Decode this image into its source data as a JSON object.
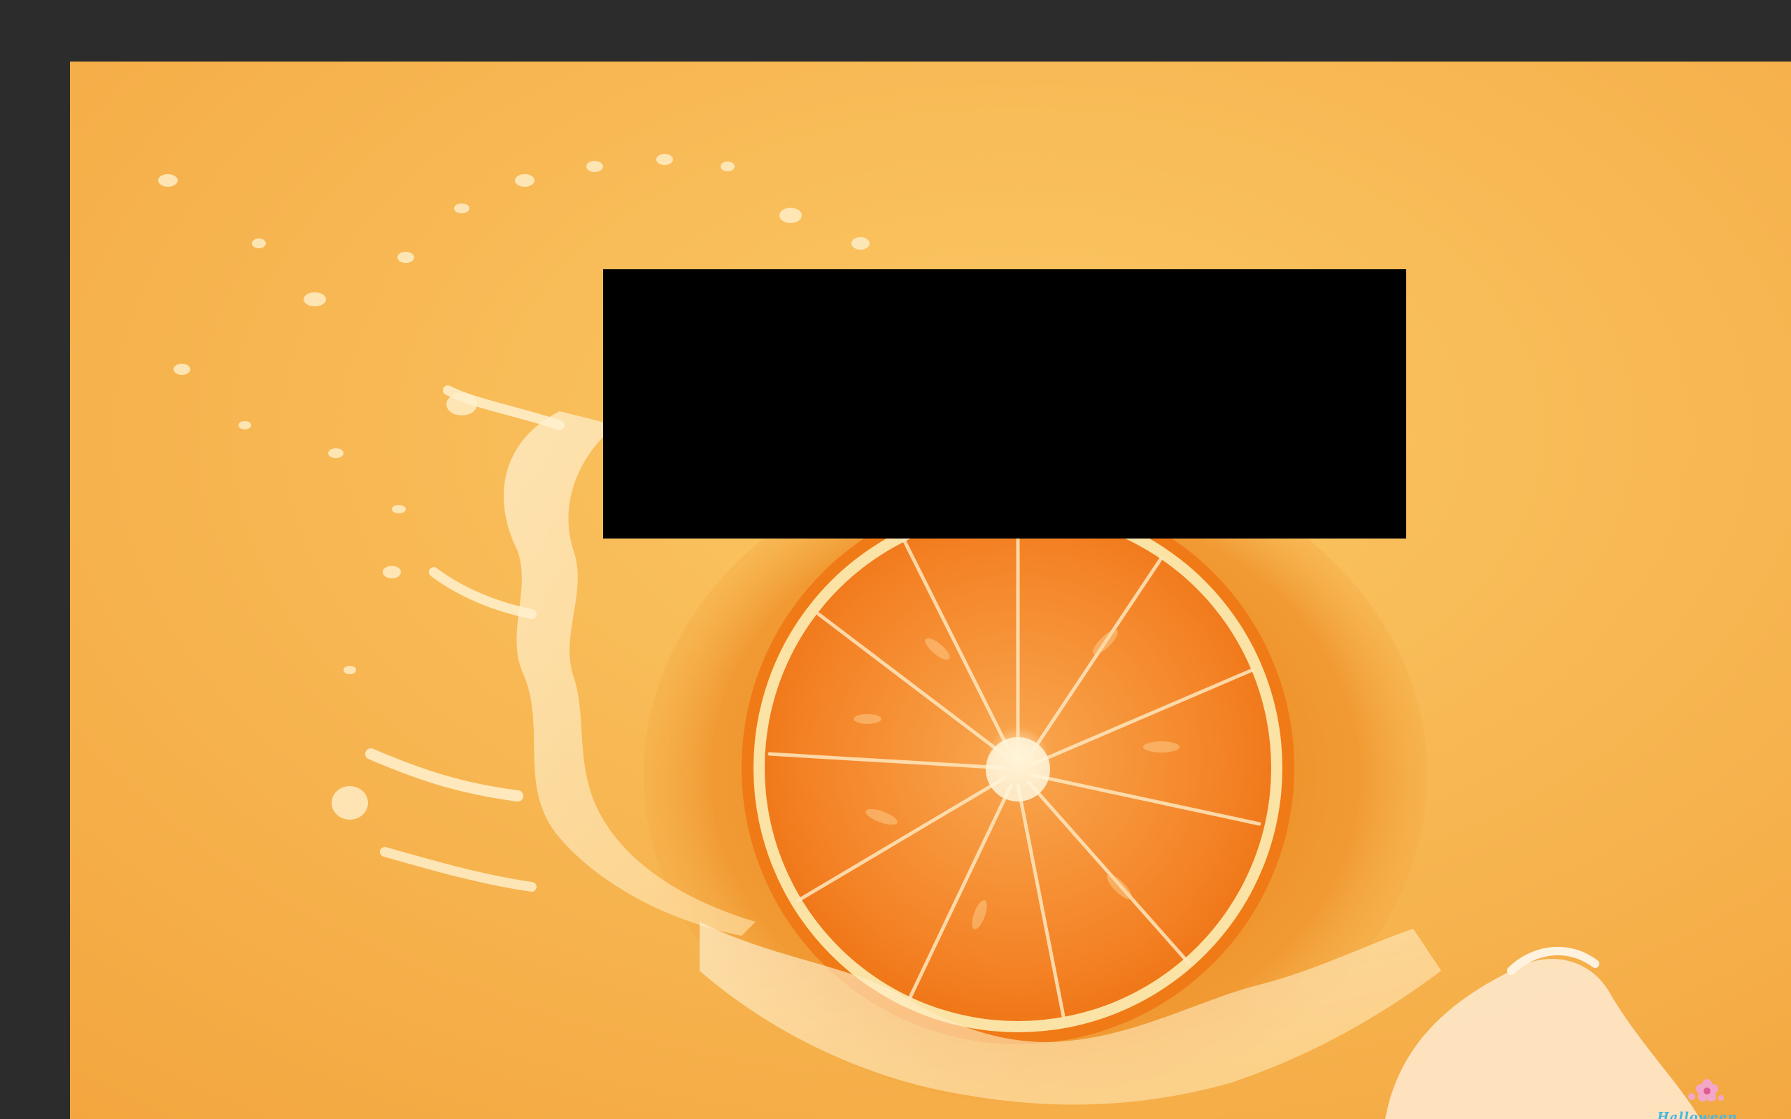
{
  "viewer": {
    "background_color": "#2c2c2c"
  },
  "image": {
    "subject": "orange-slice-in-juice-splash",
    "palette": {
      "juice": "#f6b24d",
      "juice_light": "#fbd07a",
      "juice_shadow": "#ee9a2e",
      "peel": "#f07a16",
      "pith": "#fff1c2",
      "pulp": "#f58a2a"
    },
    "redaction_color": "#000000"
  },
  "watermark": {
    "text": "Halloween",
    "icon": "flower-logo-icon",
    "color": "#48b8e0"
  }
}
